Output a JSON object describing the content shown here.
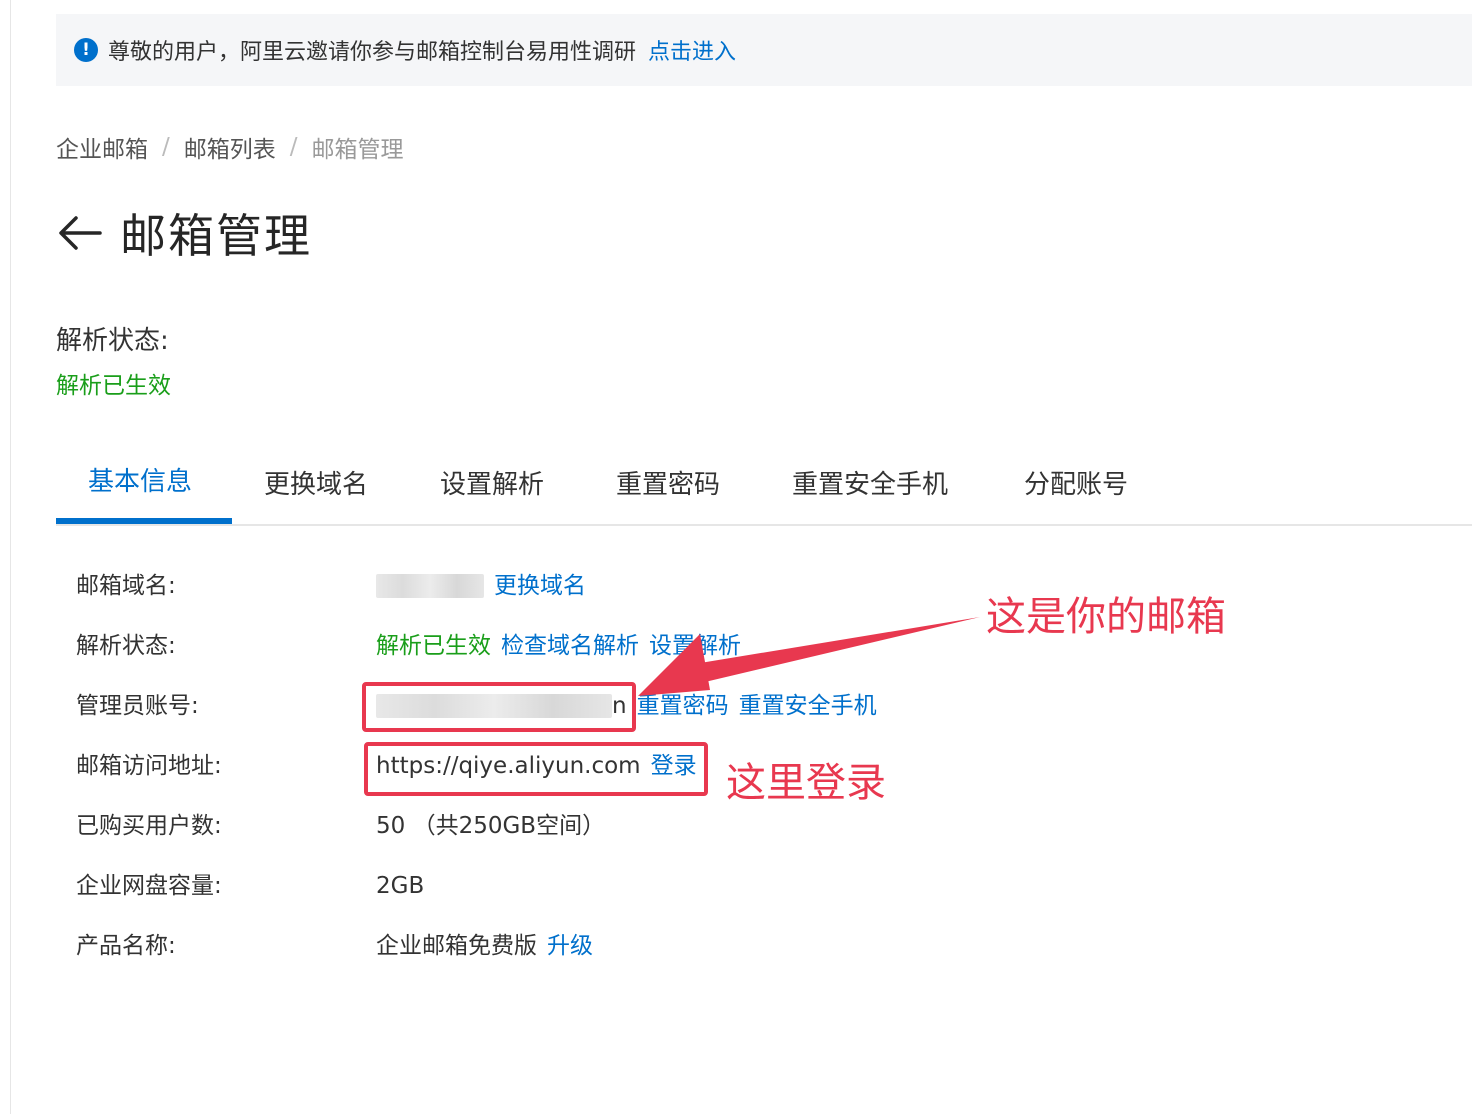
{
  "notice": {
    "text": "尊敬的用户，阿里云邀请你参与邮箱控制台易用性调研",
    "link": "点击进入"
  },
  "breadcrumb": {
    "items": [
      "企业邮箱",
      "邮箱列表",
      "邮箱管理"
    ],
    "separator": "/"
  },
  "page_title": "邮箱管理",
  "resolve_status": {
    "label": "解析状态:",
    "value": "解析已生效"
  },
  "tabs": [
    {
      "label": "基本信息",
      "active": true
    },
    {
      "label": "更换域名",
      "active": false
    },
    {
      "label": "设置解析",
      "active": false
    },
    {
      "label": "重置密码",
      "active": false
    },
    {
      "label": "重置安全手机",
      "active": false
    },
    {
      "label": "分配账号",
      "active": false
    }
  ],
  "info": {
    "domain": {
      "label": "邮箱域名:",
      "action": "更换域名"
    },
    "resolve": {
      "label": "解析状态:",
      "value": "解析已生效",
      "check_link": "检查域名解析",
      "setup_link": "设置解析"
    },
    "admin": {
      "label": "管理员账号:",
      "value_suffix": "n",
      "reset_pwd": "重置密码",
      "reset_phone": "重置安全手机"
    },
    "access": {
      "label": "邮箱访问地址:",
      "url": "https://qiye.aliyun.com",
      "login": "登录"
    },
    "users": {
      "label": "已购买用户数:",
      "value": "50 （共250GB空间）"
    },
    "disk": {
      "label": "企业网盘容量:",
      "value": "2GB"
    },
    "product": {
      "label": "产品名称:",
      "value": "企业邮箱免费版",
      "upgrade": "升级"
    }
  },
  "annotations": {
    "email_note": "这是你的邮箱",
    "login_note": "这里登录",
    "color": "#e8384f"
  },
  "colors": {
    "accent": "#0070cc",
    "success": "#1a9e1a",
    "notice_bg": "#f5f6f8"
  }
}
